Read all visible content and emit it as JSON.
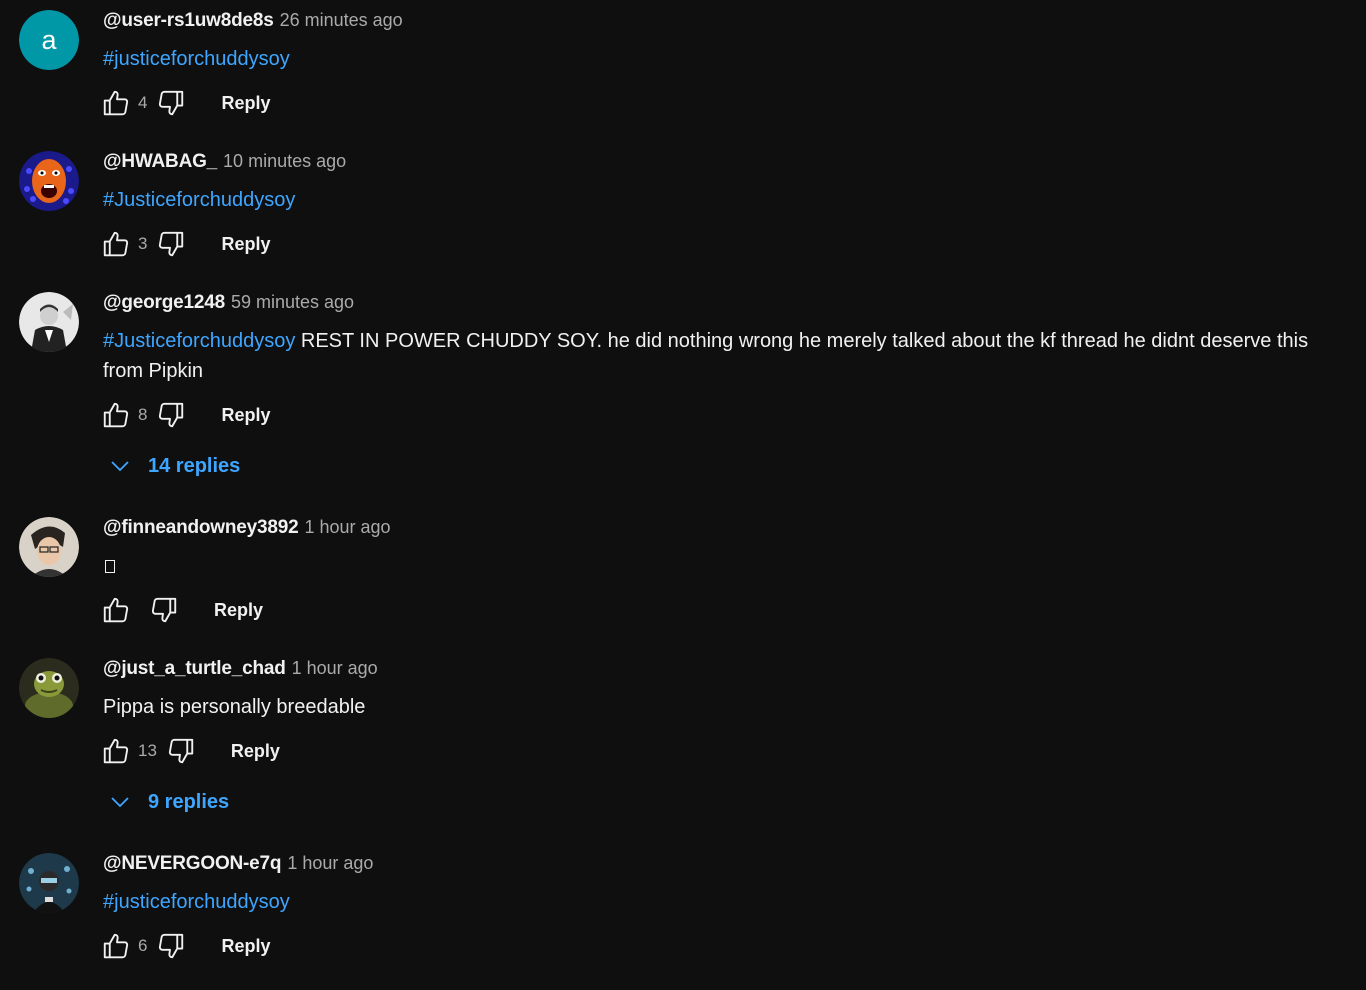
{
  "labels": {
    "reply": "Reply"
  },
  "colors": {
    "background": "#0f0f0f",
    "hashtag": "#3ea6ff",
    "muted": "#aaaaaa",
    "text": "#f1f1f1"
  },
  "comments": [
    {
      "author": "@user-rs1uw8de8s",
      "time": "26 minutes ago",
      "hashtag": "#justiceforchuddysoy",
      "text": "",
      "likes": "4",
      "avatar": {
        "type": "letter",
        "letter": "a",
        "color": "#0097a7"
      }
    },
    {
      "author": "@HWABAG_",
      "time": "10 minutes ago",
      "hashtag": "#Justiceforchuddysoy",
      "text": "",
      "likes": "3",
      "avatar": {
        "type": "image",
        "icon": "screaming-face-avatar"
      }
    },
    {
      "author": "@george1248",
      "time": "59 minutes ago",
      "hashtag": "#Justiceforchuddysoy",
      "text": " REST IN POWER CHUDDY SOY. he did nothing wrong he merely talked about the kf thread he didnt deserve this from Pipkin",
      "likes": "8",
      "replies": "14 replies",
      "avatar": {
        "type": "image",
        "icon": "suited-man-avatar"
      }
    },
    {
      "author": "@finneandowney3892",
      "time": "1 hour ago",
      "hashtag": "",
      "text": "",
      "likes": "",
      "avatar": {
        "type": "image",
        "icon": "person-portrait-avatar"
      }
    },
    {
      "author": "@just_a_turtle_chad",
      "time": "1 hour ago",
      "hashtag": "",
      "text": "Pippa is personally breedable",
      "likes": "13",
      "replies": "9 replies",
      "avatar": {
        "type": "image",
        "icon": "turtle-avatar"
      }
    },
    {
      "author": "@NEVERGOON-e7q",
      "time": "1 hour ago",
      "hashtag": "#justiceforchuddysoy",
      "text": "",
      "likes": "6",
      "avatar": {
        "type": "image",
        "icon": "dark-figure-avatar"
      }
    }
  ]
}
